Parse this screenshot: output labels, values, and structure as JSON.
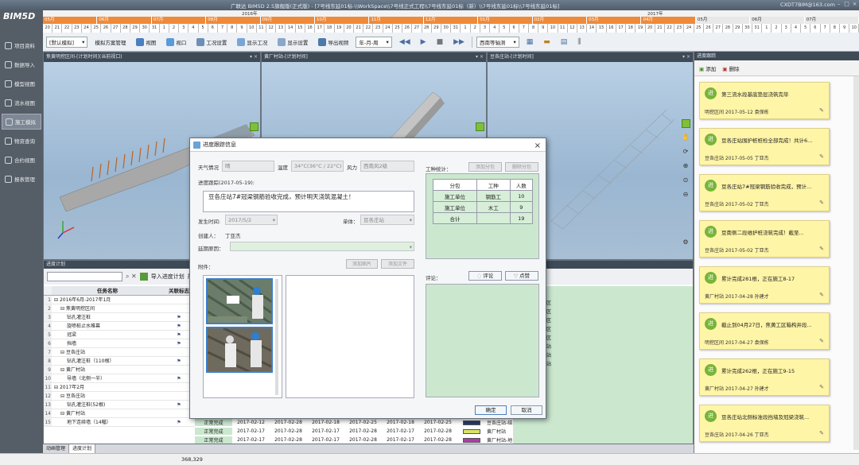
{
  "app": {
    "logo": "BIM5D",
    "title": "广联达 BIM5D 2.5旗舰版(正式版) - [7号线东延01标-\\\\WorkSpace\\\\7号线正式工程\\\\7号线东延01标（新）\\\\7号线东延01标\\\\7号线东延01标]",
    "user": "CXDT7BIM@163.com",
    "window_buttons": [
      "–",
      "□",
      "×"
    ]
  },
  "timeline": {
    "years": [
      "2016年",
      "2017年"
    ],
    "months_orange": [
      "05月",
      "06月",
      "07月",
      "08月",
      "09月",
      "10月",
      "11月",
      "12月",
      "01月",
      "02月",
      "03月",
      "04月"
    ],
    "months_gray": [
      "05月",
      "06月",
      "07月"
    ],
    "days": [
      "20",
      "21",
      "22",
      "23",
      "24",
      "25",
      "26",
      "27",
      "28",
      "29",
      "30",
      "31",
      "1",
      "2",
      "3",
      "4",
      "5",
      "6",
      "7",
      "8",
      "9",
      "10",
      "11",
      "12",
      "13",
      "14",
      "15",
      "16",
      "17",
      "18",
      "19",
      "20",
      "21",
      "22",
      "23",
      "24",
      "25",
      "26",
      "27",
      "28",
      "29",
      "30",
      "31",
      "1",
      "2",
      "3",
      "4",
      "5",
      "6",
      "7",
      "8",
      "9",
      "10",
      "11",
      "12",
      "13",
      "14",
      "15",
      "16",
      "17",
      "18",
      "19",
      "20",
      "21",
      "22",
      "23",
      "24",
      "25",
      "26",
      "27",
      "28",
      "29",
      "30",
      "31",
      "1",
      "2",
      "3",
      "4",
      "5",
      "6",
      "7",
      "8",
      "9",
      "10"
    ]
  },
  "toolbar": {
    "scheme_select": "[默认模拟]",
    "scheme_manage": "模拟方案管理",
    "view": "视图",
    "viewport": "视口",
    "work_settings": "工况设置",
    "show_work": "显示工况",
    "display_settings": "显示设置",
    "export_video": "导出视频",
    "time_unit": "年-月-周",
    "view_angle": "西南等轴测"
  },
  "sidebar": {
    "items": [
      {
        "label": "项目资料",
        "active": false
      },
      {
        "label": "数据导入",
        "active": false
      },
      {
        "label": "模型视图",
        "active": false
      },
      {
        "label": "流水视图",
        "active": false
      },
      {
        "label": "施工模拟",
        "active": true
      },
      {
        "label": "物资查询",
        "active": false
      },
      {
        "label": "合约视图",
        "active": false
      },
      {
        "label": "报表管理",
        "active": false
      }
    ]
  },
  "views": [
    {
      "title": "焦黄明挖区间-[计划时间](当前视口)"
    },
    {
      "title": "黄厂村站-[计划时间]"
    },
    {
      "title": "豆各庄站-[计划时间]"
    }
  ],
  "schedule": {
    "title": "进度计划",
    "import_btn": "导入进度计划",
    "expand_btn": "展",
    "col_task": "任务名称",
    "col_flag": "关联标志",
    "rows": [
      {
        "n": "1",
        "indent": 0,
        "name": "2016年6月-2017年1月",
        "flag": ""
      },
      {
        "n": "2",
        "indent": 1,
        "name": "焦黄明挖区间",
        "flag": ""
      },
      {
        "n": "3",
        "indent": 2,
        "name": "钻孔灌注桩",
        "flag": "⚑"
      },
      {
        "n": "4",
        "indent": 2,
        "name": "旋喷桩止水帷幕",
        "flag": "⚑"
      },
      {
        "n": "5",
        "indent": 2,
        "name": "冠梁",
        "flag": "⚑"
      },
      {
        "n": "6",
        "indent": 2,
        "name": "挡墙",
        "flag": "⚑"
      },
      {
        "n": "7",
        "indent": 1,
        "name": "豆各庄站",
        "flag": ""
      },
      {
        "n": "8",
        "indent": 2,
        "name": "钻孔灌注桩（110根）",
        "flag": "⚑"
      },
      {
        "n": "9",
        "indent": 1,
        "name": "黄厂村站",
        "flag": ""
      },
      {
        "n": "10",
        "indent": 2,
        "name": "导墙（北侧一半）",
        "flag": "⚑"
      },
      {
        "n": "11",
        "indent": 0,
        "name": "2017年2月",
        "flag": ""
      },
      {
        "n": "12",
        "indent": 1,
        "name": "豆各庄站",
        "flag": ""
      },
      {
        "n": "13",
        "indent": 2,
        "name": "钻孔灌注桩(52根)",
        "flag": "⚑"
      },
      {
        "n": "14",
        "indent": 1,
        "name": "黄厂村站",
        "flag": ""
      },
      {
        "n": "15",
        "indent": 2,
        "name": "地下连续墙（14幅）",
        "flag": "⚑"
      }
    ],
    "gantt_rows": [
      {
        "status": "正常完成",
        "d1": "2017-02-12",
        "d2": "2017-02-28",
        "d3": "2017-02-18",
        "d4": "2017-02-25",
        "d5": "2017-02-18",
        "d6": "2017-02-25",
        "bar": "#243b6b",
        "loc": "豆各庄站-结"
      },
      {
        "status": "正常完成",
        "d1": "2017-02-17",
        "d2": "2017-02-28",
        "d3": "2017-02-17",
        "d4": "2017-02-28",
        "d5": "2017-02-17",
        "d6": "2017-02-28",
        "bar": "#d8e36a",
        "loc": "黄厂村站"
      },
      {
        "status": "正常完成",
        "d1": "2017-02-17",
        "d2": "2017-02-28",
        "d3": "2017-02-17",
        "d4": "2017-02-28",
        "d5": "2017-02-17",
        "d6": "2017-02-28",
        "bar": "#b03ab0",
        "loc": "黄厂村站-地"
      }
    ],
    "side_labels": [
      "区",
      "区",
      "区",
      "区",
      "区",
      "站",
      "站",
      "站"
    ]
  },
  "bottom_tabs": [
    "动画管理",
    "进度计划"
  ],
  "status_value": "368,329",
  "progress": {
    "title": "进度跟踪",
    "add": "添加",
    "delete": "删除",
    "cards": [
      {
        "badge": "进",
        "text": "第三流水段基底垫层浇筑完毕",
        "meta": "明挖区间 2017-05-12 袁保栋"
      },
      {
        "badge": "进",
        "text": "豆各庄站围护桩桩检全部完成！共计6...",
        "meta": "豆各庄站 2017-05-05 丁亚杰"
      },
      {
        "badge": "进",
        "text": "豆各庄站7#冠梁钢筋验收完成，预计...",
        "meta": "豆各庄站 2017-05-02 丁亚杰"
      },
      {
        "badge": "进",
        "text": "豆南侧二段维护桩浇筑完成！截至...",
        "meta": "豆各庄站 2017-05-02 丁亚杰"
      },
      {
        "badge": "进",
        "text": "累计完成281根，正在施工8-17",
        "meta": "黄厂村站 2017-04-28 孙建才"
      },
      {
        "badge": "进",
        "text": "截止到04月27日，焦黄工区箱构井段...",
        "meta": "明挖区间 2017-04-27 袁保栋"
      },
      {
        "badge": "进",
        "text": "累计完成262根，正在施工9-15",
        "meta": "黄厂村站 2017-04-27 孙建才"
      },
      {
        "badge": "进",
        "text": "豆各庄站北侧标准段挡墙及冠梁浇筑...",
        "meta": "豆各庄站 2017-04-26 丁亚杰"
      }
    ]
  },
  "dialog": {
    "title": "进度跟踪信息",
    "weather_label": "天气情况",
    "weather_value": "晴",
    "temp_label": "温度",
    "temp_value": "34°C(36°C / 22°C)",
    "wind_label": "风力",
    "wind_value": "西南风2级",
    "tracking_label": "进度跟踪(2017-05-19):",
    "tracking_text": "豆各庄站7#冠梁钢筋验收完成，预计明天浇筑混凝土！",
    "time_label": "发生时间:",
    "time_value": "2017/5/2",
    "unit_label": "单体：",
    "unit_value": "豆各庄站",
    "creator_label": "创建人：",
    "creator_value": "丁亚杰",
    "delay_label": "延期原因：",
    "attach_label": "附件：",
    "add_image": "添加图片",
    "add_file": "添加文件",
    "worker_label": "工种统计：",
    "add_sub": "添加分包",
    "del_sub": "删除分包",
    "stat_headers": [
      "分包",
      "工种",
      "人数"
    ],
    "stat_rows": [
      {
        "a": "施工单位",
        "b": "钢筋工",
        "c": "10"
      },
      {
        "a": "施工单位",
        "b": "木工",
        "c": "9"
      },
      {
        "a": "合计",
        "b": "",
        "c": "19"
      }
    ],
    "comment_label": "评论：",
    "comment_btn": "评论",
    "like_btn": "点赞",
    "ok": "确定",
    "cancel": "取消"
  }
}
